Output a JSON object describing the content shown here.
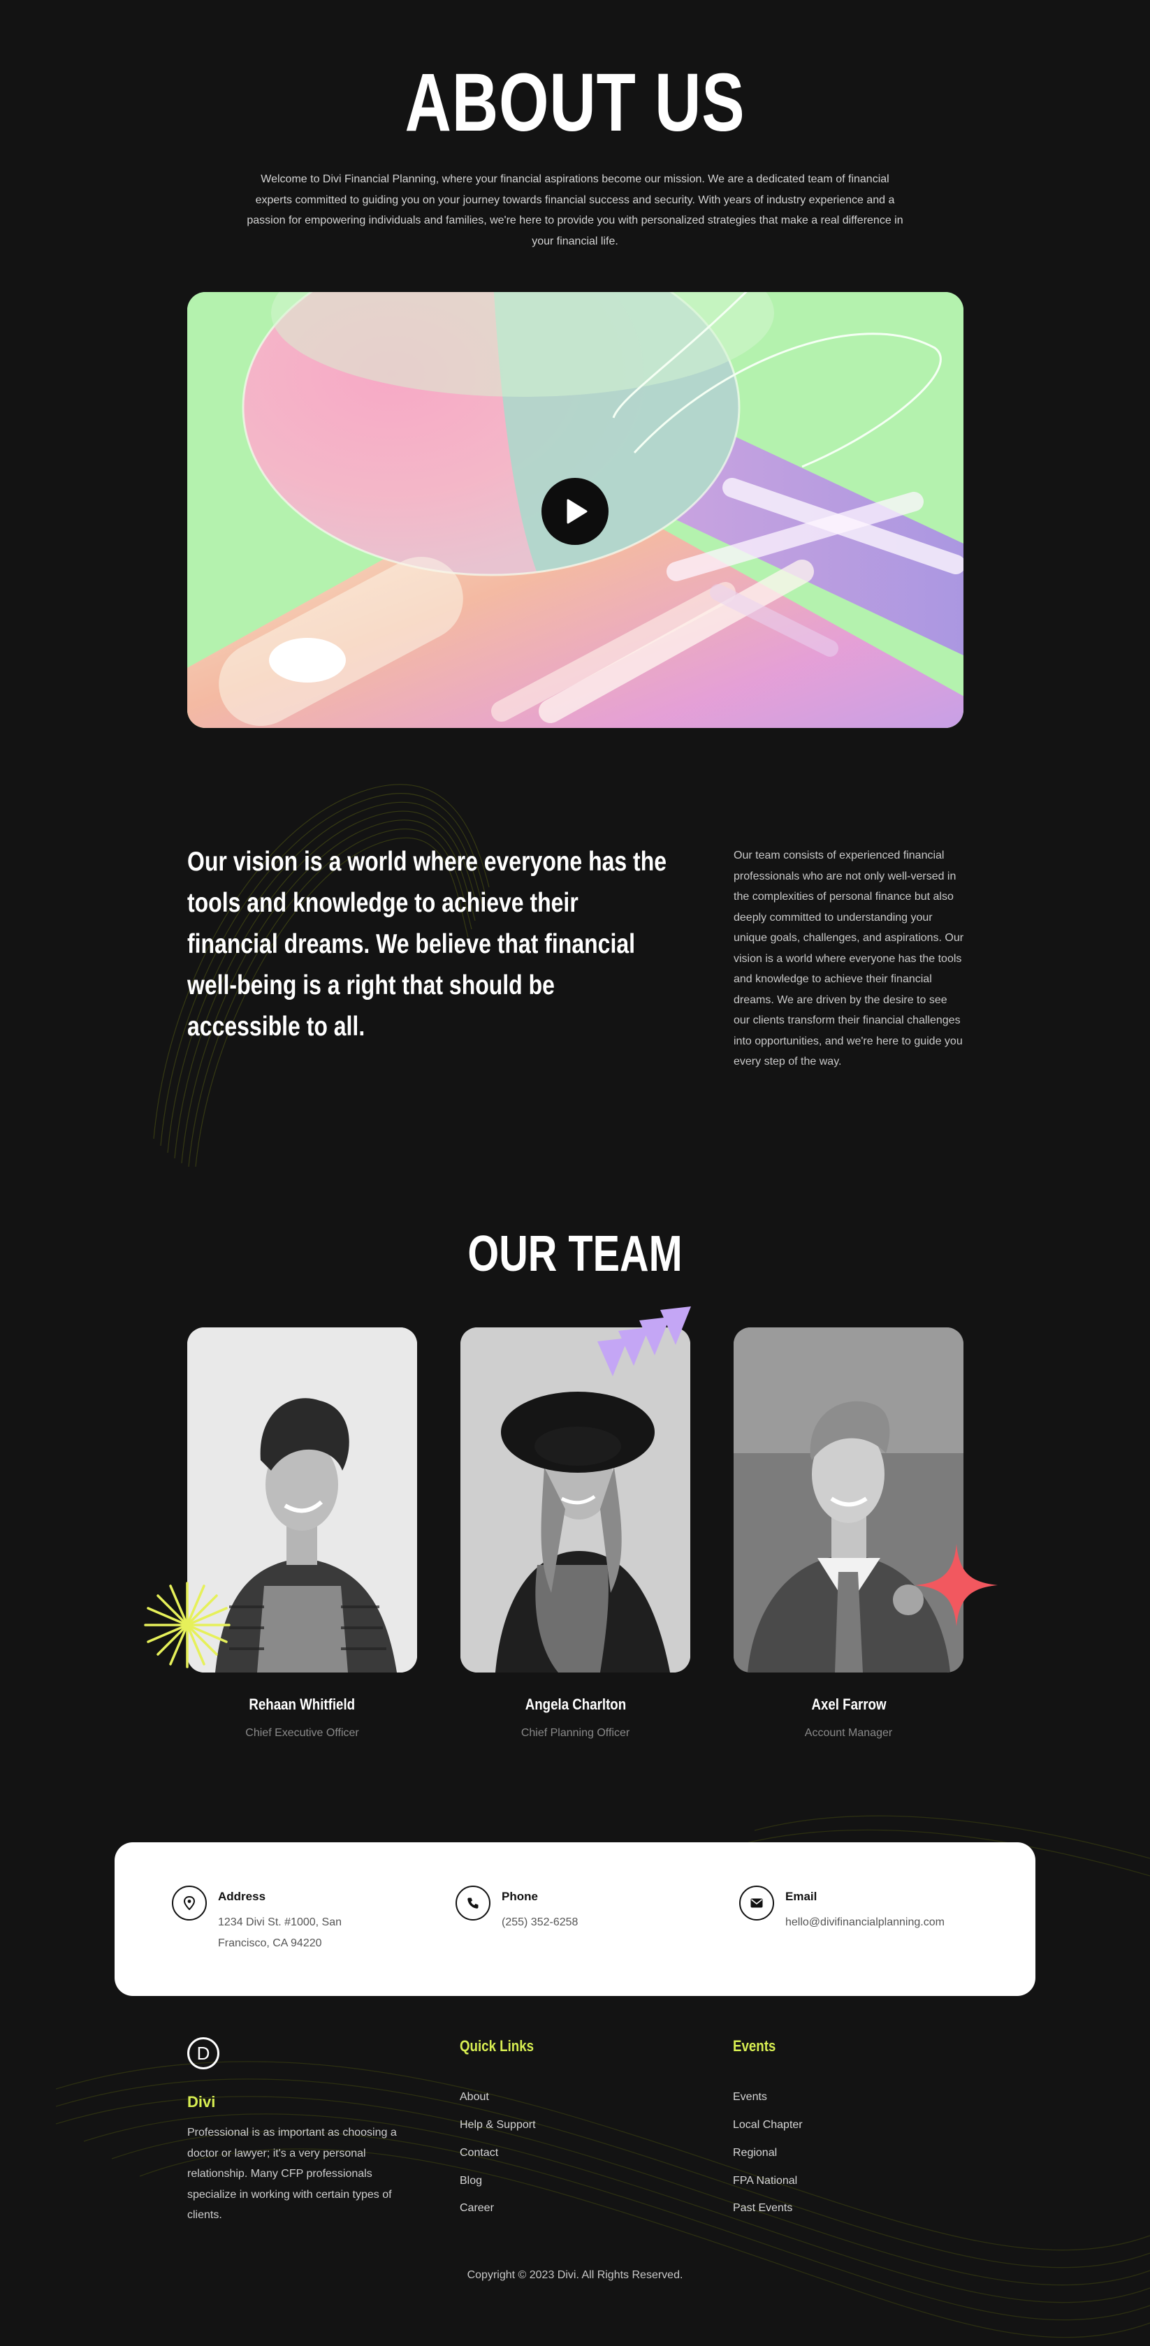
{
  "about": {
    "title": "ABOUT US",
    "intro": "Welcome to Divi Financial Planning, where your financial aspirations become our mission. We are a dedicated team of financial experts committed to guiding you on your journey towards financial success and security. With years of industry experience and a passion for empowering individuals and families, we're here to provide you with personalized strategies that make a real difference in your financial life.",
    "play_icon": "play-icon"
  },
  "vision": {
    "quote_lines": [
      "Our vision is a world where everyone has the",
      "tools and knowledge to achieve their",
      "financial dreams. We believe that financial",
      "well-being is a right that should be",
      "accessible to all."
    ],
    "text": "Our team consists of experienced financial professionals who are not only well-versed in the complexities of personal finance but also deeply committed to understanding your unique goals, challenges, and aspirations. Our vision is a world where everyone has the tools and knowledge to achieve their financial dreams. We are driven by the desire to see our clients transform their financial challenges into opportunities, and we're here to guide you every step of the way."
  },
  "team": {
    "title": "OUR TEAM",
    "members": [
      {
        "name": "Rehaan Whitfield",
        "role": "Chief Executive Officer"
      },
      {
        "name": "Angela Charlton",
        "role": "Chief Planning Officer"
      },
      {
        "name": "Axel Farrow",
        "role": "Account Manager"
      }
    ]
  },
  "contact": {
    "address": {
      "label": "Address",
      "lines": [
        "1234 Divi St. #1000, San",
        "Francisco, CA 94220"
      ],
      "icon": "location-pin-icon"
    },
    "phone": {
      "label": "Phone",
      "value": "(255) 352-6258",
      "icon": "phone-icon"
    },
    "email": {
      "label": "Email",
      "value": "hello@divifinancialplanning.com",
      "icon": "envelope-icon"
    }
  },
  "footer": {
    "logo_letter": "D",
    "brand": "Divi",
    "description": "Professional is as important as choosing a doctor or lawyer; it's a very personal relationship. Many CFP professionals specialize in working with certain types of clients.",
    "quick_links": {
      "heading": "Quick Links",
      "items": [
        "About",
        "Help & Support",
        "Contact",
        "Blog",
        "Career"
      ]
    },
    "events": {
      "heading": "Events",
      "items": [
        "Events",
        "Local Chapter",
        "Regional",
        "FPA National",
        "Past Events"
      ]
    },
    "copyright": "Copyright © 2023 Divi. All Rights Reserved."
  },
  "colors": {
    "background": "#131313",
    "accent": "#d8ef52",
    "card": "#ffffff",
    "lilac": "#c4a6f5",
    "coral": "#f2585f"
  }
}
